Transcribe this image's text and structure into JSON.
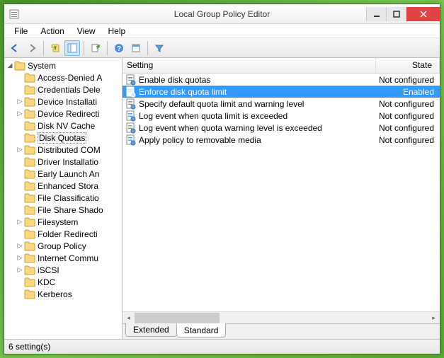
{
  "window": {
    "title": "Local Group Policy Editor"
  },
  "menu": {
    "items": [
      "File",
      "Action",
      "View",
      "Help"
    ]
  },
  "tree": {
    "root": {
      "label": "System",
      "expanded": true,
      "level": 0
    },
    "children": [
      {
        "label": "Access-Denied A",
        "expander": ""
      },
      {
        "label": "Credentials Dele",
        "expander": ""
      },
      {
        "label": "Device Installati",
        "expander": ">"
      },
      {
        "label": "Device Redirecti",
        "expander": ">"
      },
      {
        "label": "Disk NV Cache",
        "expander": ""
      },
      {
        "label": "Disk Quotas",
        "expander": "",
        "selected": true
      },
      {
        "label": "Distributed COM",
        "expander": ">"
      },
      {
        "label": "Driver Installatio",
        "expander": ""
      },
      {
        "label": "Early Launch An",
        "expander": ""
      },
      {
        "label": "Enhanced Stora",
        "expander": ""
      },
      {
        "label": "File Classificatio",
        "expander": ""
      },
      {
        "label": "File Share Shado",
        "expander": ""
      },
      {
        "label": "Filesystem",
        "expander": ">"
      },
      {
        "label": "Folder Redirecti",
        "expander": ""
      },
      {
        "label": "Group Policy",
        "expander": ">"
      },
      {
        "label": "Internet Commu",
        "expander": ">"
      },
      {
        "label": "iSCSI",
        "expander": ">"
      },
      {
        "label": "KDC",
        "expander": ""
      },
      {
        "label": "Kerberos",
        "expander": ""
      }
    ]
  },
  "list": {
    "columns": {
      "setting": "Setting",
      "state": "State"
    },
    "rows": [
      {
        "setting": "Enable disk quotas",
        "state": "Not configured",
        "selected": false
      },
      {
        "setting": "Enforce disk quota limit",
        "state": "Enabled",
        "selected": true
      },
      {
        "setting": "Specify default quota limit and warning level",
        "state": "Not configured",
        "selected": false
      },
      {
        "setting": "Log event when quota limit is exceeded",
        "state": "Not configured",
        "selected": false
      },
      {
        "setting": "Log event when quota warning level is exceeded",
        "state": "Not configured",
        "selected": false
      },
      {
        "setting": "Apply policy to removable media",
        "state": "Not configured",
        "selected": false
      }
    ]
  },
  "tabs": {
    "extended": "Extended",
    "standard": "Standard",
    "active": "standard"
  },
  "status": {
    "text": "6 setting(s)"
  }
}
